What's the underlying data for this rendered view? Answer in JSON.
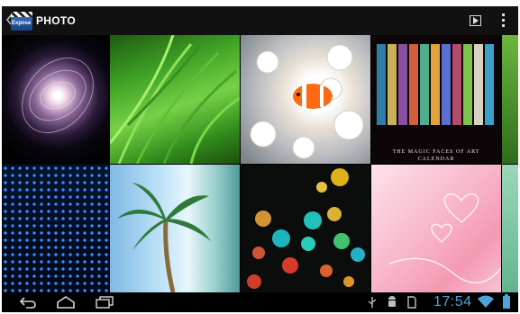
{
  "actionbar": {
    "app_icon": "clapperboard-icon",
    "app_icon_text": "Expose",
    "title": "PHOTO",
    "slideshow_icon": "play-icon",
    "overflow_icon": "more-vert-icon"
  },
  "grid": {
    "tiles": [
      {
        "name": "photo-spiral-galaxy"
      },
      {
        "name": "photo-green-grass"
      },
      {
        "name": "photo-clownfish-anemone"
      },
      {
        "name": "photo-art-calendar",
        "caption_line1": "THE MAGIC FACES OF ART",
        "caption_line2": "CALENDAR"
      },
      {
        "name": "photo-green-partial"
      },
      {
        "name": "photo-blue-dot-pattern"
      },
      {
        "name": "photo-palm-tree-beach"
      },
      {
        "name": "photo-colorful-bokeh"
      },
      {
        "name": "photo-pink-hearts"
      },
      {
        "name": "photo-green-partial-2"
      }
    ]
  },
  "navbar": {
    "back_icon": "back-icon",
    "home_icon": "home-icon",
    "recents_icon": "recent-apps-icon",
    "usb_icon": "usb-icon",
    "android_icon": "android-debug-icon",
    "sd_icon": "sd-card-icon",
    "time": "17:54",
    "wifi_icon": "wifi-icon",
    "battery_icon": "battery-icon"
  },
  "colors": {
    "actionbar_bg": "#111111",
    "navbar_bg": "#000000",
    "clock": "#4fa3d9"
  }
}
